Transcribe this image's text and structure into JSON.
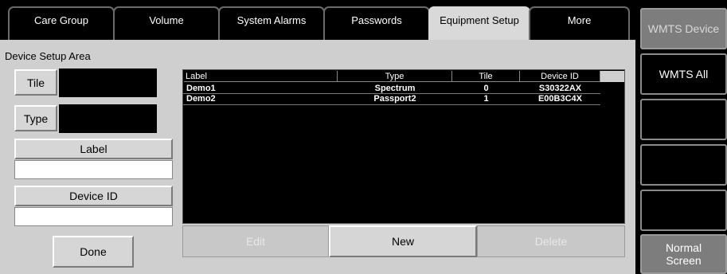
{
  "tabs": [
    {
      "label": "Care Group"
    },
    {
      "label": "Volume"
    },
    {
      "label": "System Alarms"
    },
    {
      "label": "Passwords"
    },
    {
      "label": "Equipment Setup",
      "active": true
    },
    {
      "label": "More"
    }
  ],
  "panel": {
    "title": "Device Setup Area",
    "tile_label": "Tile",
    "type_label": "Type",
    "label_label": "Label",
    "device_id_label": "Device ID",
    "label_value": "",
    "device_id_value": "",
    "done_label": "Done"
  },
  "table": {
    "headers": [
      "Label",
      "Type",
      "Tile",
      "Device ID"
    ],
    "rows": [
      [
        "Demo1",
        "Spectrum",
        "0",
        "S30322AX"
      ],
      [
        "Demo2",
        "Passport2",
        "1",
        "E00B3C4X"
      ]
    ]
  },
  "actions": {
    "edit": "Edit",
    "new": "New",
    "delete": "Delete"
  },
  "sidebar": {
    "wmts_device": "WMTS Device",
    "wmts_all": "WMTS All",
    "normal_screen": "Normal Screen"
  }
}
